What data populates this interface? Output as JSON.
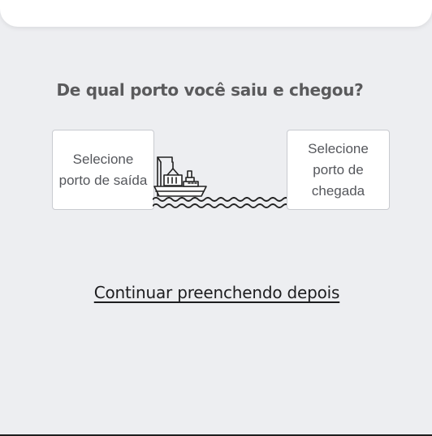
{
  "question": {
    "text": "De qual porto você saiu e chegou?"
  },
  "ports": {
    "origin_label": "Selecione porto de saída",
    "destination_label": "Selecione porto de chegada"
  },
  "continue_later": {
    "label": "Continuar preenchendo depois"
  },
  "illustration": {
    "icon": "cargo-ship-icon",
    "wave_icon": "water-waves-icon"
  },
  "colors": {
    "background": "#edeef1",
    "card": "#ffffff",
    "text_heading": "#5a5a5c",
    "text_body": "#55575c",
    "link": "#1d1d1f",
    "box_border": "#c9cbd0",
    "illustration_stroke": "#222222"
  }
}
